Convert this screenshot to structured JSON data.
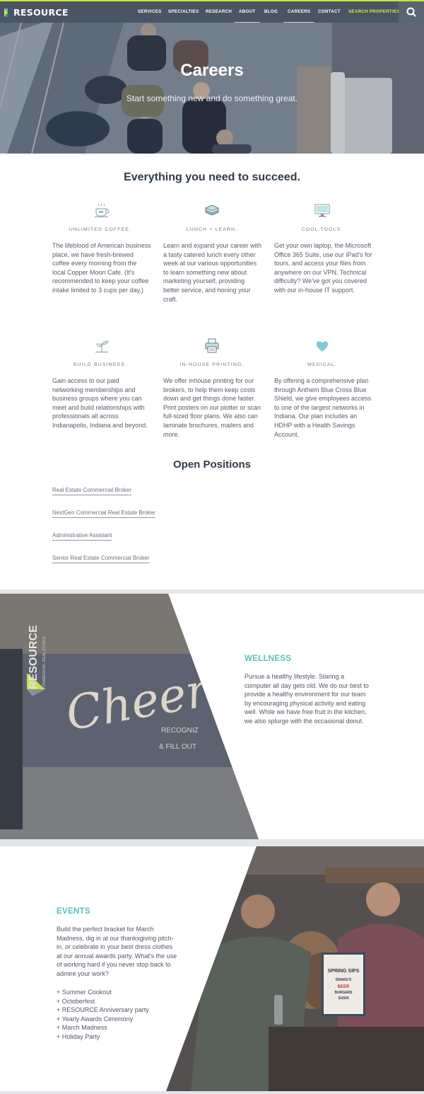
{
  "nav": {
    "logo_text": "RESOURCE",
    "items": [
      "SERVICES",
      "SPECIALTIES",
      "RESEARCH",
      "ABOUT",
      "BLOG",
      "CAREERS",
      "CONTACT",
      "SEARCH PROPERTIES"
    ],
    "active": [
      "ABOUT",
      "CAREERS"
    ],
    "search_icon": "search-icon"
  },
  "hero": {
    "title": "Careers",
    "subtitle": "Start something new and do something great."
  },
  "benefits": {
    "title": "Everything you need to succeed.",
    "items": [
      {
        "icon": "coffee-cup-icon",
        "label": "UNLIMITED COFFEE.",
        "text": "The lifeblood of American business place, we have fresh-brewed coffee every morning from the local Copper Moon Cafe. (It's recommended to keep your coffee intake limited to 3 cups per day.)"
      },
      {
        "icon": "sandwich-icon",
        "label": "LUNCH + LEARN.",
        "text": "Learn and expand your career with a tasty catered lunch every other week at our various opportunities to learn something new about marketing yourself, providing better service, and honing your craft."
      },
      {
        "icon": "computer-monitor-icon",
        "label": "COOL TOOLS.",
        "text": "Get your own laptop, the Microsoft Office 365 Suite, use our iPad's for tours, and access your files from anywhere on our VPN. Technical difficulty? We've got you covered with our in-house IT support."
      },
      {
        "icon": "sprout-icon",
        "label": "BUILD BUSINESS.",
        "text": "Gain access to our paid networking memberships and business groups where you can meet and build relationships with professionals all across Indianapolis, Indiana and beyond."
      },
      {
        "icon": "printer-icon",
        "label": "IN-HOUSE PRINTING.",
        "text": "We offer inhouse printing for our brokers, to help them keep costs down and get things done faster. Print posters on our plotter or scan full-sized floor plans. We also can laminate brochures, mailers and more."
      },
      {
        "icon": "heart-icon",
        "label": "MEDICAL.",
        "text": "By offering a comprehensive plan through Anthem Blue Cross Blue Shield, we give employees access to one of the largest networks in Indiana. Our plan includes an HDHP with a Health Savings Account."
      }
    ]
  },
  "positions": {
    "title": "Open Positions",
    "links": [
      "Real Estate Commercial Broker",
      "NextGen Commercial Real Estate Broker",
      "Administrative Assistant",
      "Senior Real Estate Commercial Broker"
    ]
  },
  "wellness": {
    "title": "WELLNESS",
    "text": "Pursue a healthy lifestyle. Staring a computer all day gets old. We do our best to provide a healthy environment for our team by encouraging physical activity and eating well. While we have free fruit in the kitchen, we also splurge with the occasional donut.",
    "photo": {
      "script": "Cheers!",
      "brand": "RESOURCE",
      "brand_sub": "COMMERCIAL REAL ESTATE",
      "caption_1": "RECOGNIZ",
      "caption_2": "& FILL OUT"
    }
  },
  "events": {
    "title": "EVENTS",
    "text": "Build the perfect bracket for March Madness, dig in at our thanksgiving pitch-in, or celebrate in your best dress clothes at our annual awards party. What's the use of working hard if you never stop back to admire your work?",
    "list": [
      "+ Summer Cookout",
      "+ Octoberfest",
      "+ RESOURCE Anniversary party",
      "+ Yearly Awards Ceremony",
      "+ March Madness",
      "+ Holiday Party"
    ],
    "photo": {
      "sign_1": "SPRING SIPS",
      "sign_2": "DRAKE'S",
      "sign_3": "BEER",
      "sign_4": "BURGERS",
      "sign_5": "SUSHI"
    }
  },
  "colors": {
    "nav_bg": "#4a5563",
    "nav_accent": "#c9e24a",
    "teal": "#5bbcc0",
    "heading": "#2f3a48"
  }
}
